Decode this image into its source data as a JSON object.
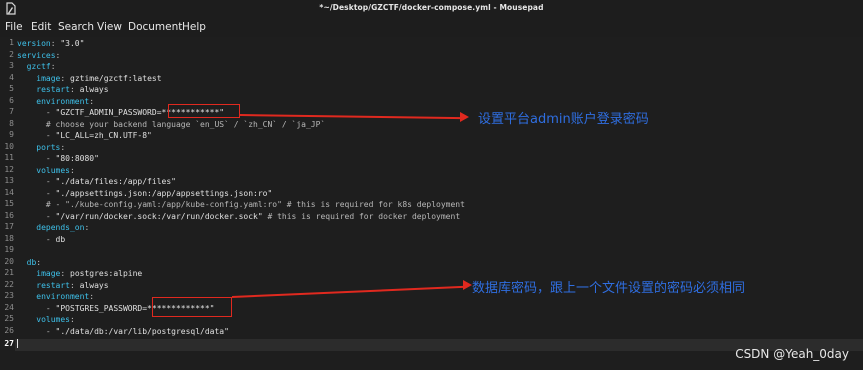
{
  "window": {
    "title": "*~/Desktop/GZCTF/docker-compose.yml - Mousepad",
    "app_icon": "text-editor-icon"
  },
  "menu": [
    "File",
    "Edit",
    "Search",
    "View",
    "Document",
    "Help"
  ],
  "editor": {
    "current_line": 27,
    "line_numbers": [
      "1",
      "2",
      "3",
      "4",
      "5",
      "6",
      "7",
      "8",
      "9",
      "10",
      "11",
      "12",
      "13",
      "14",
      "15",
      "16",
      "17",
      "18",
      "19",
      "20",
      "21",
      "22",
      "23",
      "24",
      "25",
      "26",
      "27"
    ]
  },
  "code": {
    "l1": {
      "key": "version",
      "sep": ": ",
      "value": "\"3.0\""
    },
    "l2": {
      "key": "services",
      "sep": ":"
    },
    "l3": {
      "indent": "  ",
      "key": "gzctf",
      "sep": ":"
    },
    "l4": {
      "indent": "    ",
      "key": "image",
      "sep": ": ",
      "value": "gztime/gzctf:latest"
    },
    "l5": {
      "indent": "    ",
      "key": "restart",
      "sep": ": ",
      "value": "always"
    },
    "l6": {
      "indent": "    ",
      "key": "environment",
      "sep": ":"
    },
    "l7": {
      "indent": "      ",
      "dash": "- ",
      "value": "\"GZCTF_ADMIN_PASSWORD=************\""
    },
    "l8": {
      "indent": "      ",
      "comment": "# choose your backend language `en_US` / `zh_CN` / `ja_JP`"
    },
    "l9": {
      "indent": "      ",
      "dash": "- ",
      "value": "\"LC_ALL=zh_CN.UTF-8\""
    },
    "l10": {
      "indent": "    ",
      "key": "ports",
      "sep": ":"
    },
    "l11": {
      "indent": "      ",
      "dash": "- ",
      "value": "\"80:8080\""
    },
    "l12": {
      "indent": "    ",
      "key": "volumes",
      "sep": ":"
    },
    "l13": {
      "indent": "      ",
      "dash": "- ",
      "value": "\"./data/files:/app/files\""
    },
    "l14": {
      "indent": "      ",
      "dash": "- ",
      "value": "\"./appsettings.json:/app/appsettings.json:ro\""
    },
    "l15": {
      "indent": "      ",
      "comment": "# - \"./kube-config.yaml:/app/kube-config.yaml:ro\" # this is required for k8s deployment"
    },
    "l16": {
      "indent": "      ",
      "dash": "- ",
      "value": "\"/var/run/docker.sock:/var/run/docker.sock\"",
      "trail": " # this is required for docker deployment"
    },
    "l17": {
      "indent": "    ",
      "key": "depends_on",
      "sep": ":"
    },
    "l18": {
      "indent": "      ",
      "dash": "- ",
      "value": "db"
    },
    "l20": {
      "indent": "  ",
      "key": "db",
      "sep": ":"
    },
    "l21": {
      "indent": "    ",
      "key": "image",
      "sep": ": ",
      "value": "postgres:alpine"
    },
    "l22": {
      "indent": "    ",
      "key": "restart",
      "sep": ": ",
      "value": "always"
    },
    "l23": {
      "indent": "    ",
      "key": "environment",
      "sep": ":"
    },
    "l24": {
      "indent": "      ",
      "dash": "- ",
      "value": "\"POSTGRES_PASSWORD=*************\""
    },
    "l25": {
      "indent": "    ",
      "key": "volumes",
      "sep": ":"
    },
    "l26": {
      "indent": "      ",
      "dash": "- ",
      "value": "\"./data/db:/var/lib/postgresql/data\""
    }
  },
  "annotations": {
    "admin_password": "设置平台admin账户登录密码",
    "db_password": "数据库密码，跟上一个文件设置的密码必须相同"
  },
  "annotation_color": "#2f6ee0",
  "highlight_color": "#e0291f",
  "watermark": "CSDN @Yeah_0day"
}
